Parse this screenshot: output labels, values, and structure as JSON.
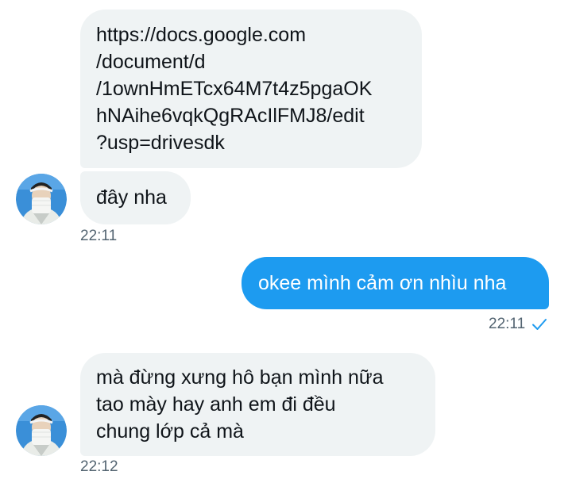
{
  "conversation": {
    "messages": [
      {
        "direction": "incoming",
        "text": "https://docs.google.com\n/document/d\n/1ownHmETcx64M7t4z5pgaOK\nhNAihe6vqkQgRAcIlFMJ8/edit\n?usp=drivesdk"
      },
      {
        "direction": "incoming",
        "text": "đây nha",
        "time": "22:11"
      },
      {
        "direction": "outgoing",
        "text": "okee mình cảm ơn nhìu nha",
        "time": "22:11",
        "status_icon": "check-icon"
      },
      {
        "direction": "incoming",
        "text": "mà đừng xưng hô bạn mình nữa\ntao mày hay anh em đi đều\nchung lớp cả mà",
        "time": "22:12"
      }
    ]
  },
  "colors": {
    "incoming_bubble": "#eff3f4",
    "outgoing_bubble": "#1d9bf0",
    "timestamp": "#536471",
    "check": "#1d9bf0"
  }
}
